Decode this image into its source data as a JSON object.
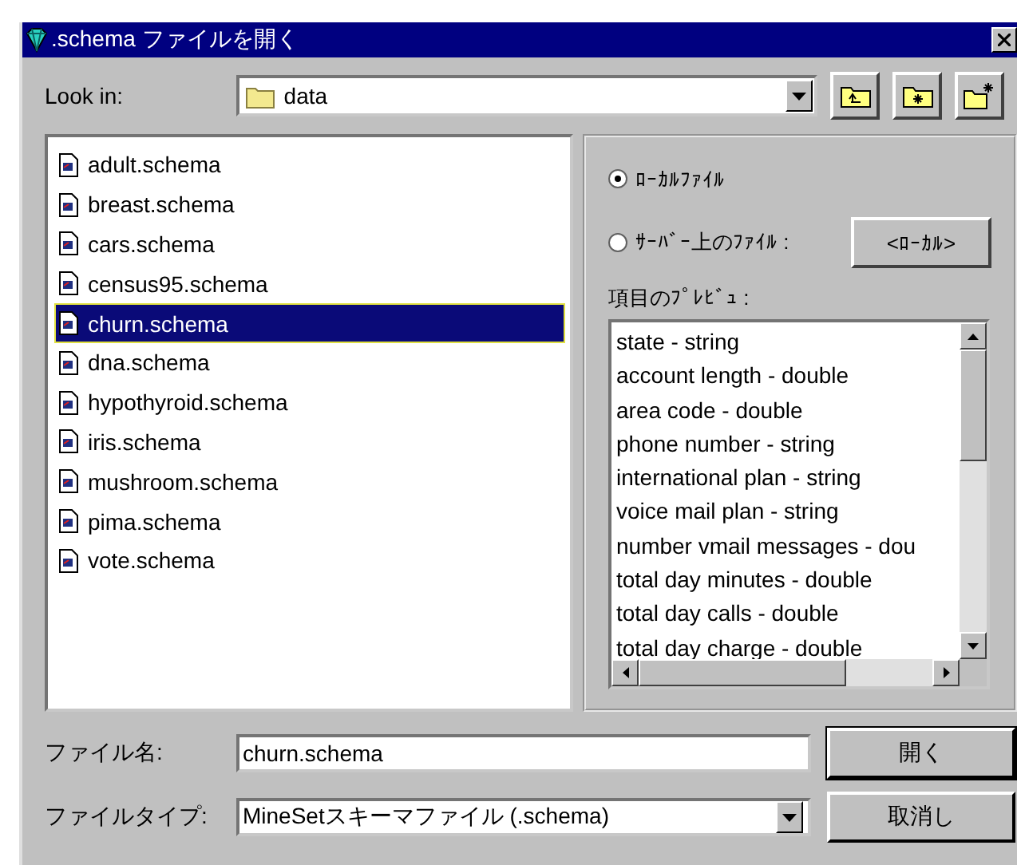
{
  "window": {
    "title": ".schema ファイルを開く"
  },
  "look_in": {
    "label": "Look in:",
    "value": "data"
  },
  "files": [
    {
      "name": "adult.schema",
      "selected": false
    },
    {
      "name": "breast.schema",
      "selected": false
    },
    {
      "name": "cars.schema",
      "selected": false
    },
    {
      "name": "census95.schema",
      "selected": false
    },
    {
      "name": "churn.schema",
      "selected": true
    },
    {
      "name": "dna.schema",
      "selected": false
    },
    {
      "name": "hypothyroid.schema",
      "selected": false
    },
    {
      "name": "iris.schema",
      "selected": false
    },
    {
      "name": "mushroom.schema",
      "selected": false
    },
    {
      "name": "pima.schema",
      "selected": false
    },
    {
      "name": "vote.schema",
      "selected": false
    }
  ],
  "source_options": [
    {
      "label": "ﾛｰｶﾙﾌｧｲﾙ",
      "selected": true
    },
    {
      "label": "ｻｰﾊﾞｰ上のﾌｧｲﾙ :",
      "selected": false
    }
  ],
  "server_button": "<ﾛｰｶﾙ>",
  "preview": {
    "label": "項目のﾌﾟﾚﾋﾞｭ :",
    "items": [
      "state - string",
      "account length - double",
      "area code - double",
      "phone number - string",
      "international plan - string",
      "voice mail plan - string",
      "number vmail messages - dou",
      "total day minutes - double",
      "total day calls - double",
      "total day charge - double"
    ]
  },
  "file_name": {
    "label": "ファイル名:",
    "value": "churn.schema"
  },
  "file_type": {
    "label": "ファイルタイプ:",
    "value": "MineSetスキーマファイル (.schema)"
  },
  "buttons": [
    "開く",
    "取消し"
  ]
}
